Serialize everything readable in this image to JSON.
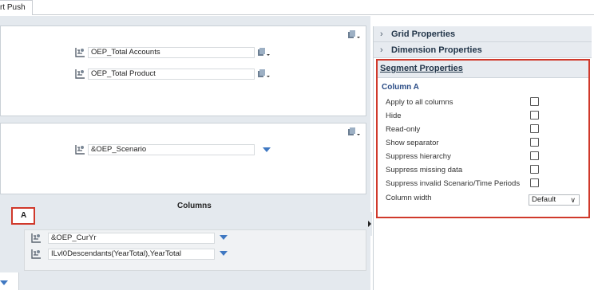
{
  "tabs": [
    {
      "label": "rt Push"
    }
  ],
  "point_of_view": {
    "dimensions": [
      {
        "value": "OEP_Total Accounts"
      },
      {
        "value": "OEP_Total Product"
      }
    ]
  },
  "page": {
    "dimensions": [
      {
        "value": "&OEP_Scenario"
      }
    ]
  },
  "columns": {
    "title": "Columns",
    "segment_label": "A",
    "dimensions": [
      {
        "value": "&OEP_CurYr"
      },
      {
        "value": "ILvl0Descendants(YearTotal),YearTotal"
      }
    ]
  },
  "properties": {
    "grid_properties": "Grid Properties",
    "dimension_properties": "Dimension Properties",
    "segment_properties": "Segment Properties",
    "segment_name": "Column A",
    "options": [
      {
        "label": "Apply to all columns",
        "checked": false
      },
      {
        "label": "Hide",
        "checked": false
      },
      {
        "label": "Read-only",
        "checked": false
      },
      {
        "label": "Show separator",
        "checked": false
      },
      {
        "label": "Suppress hierarchy",
        "checked": false
      },
      {
        "label": "Suppress missing data",
        "checked": false
      },
      {
        "label": "Suppress invalid Scenario/Time Periods",
        "checked": false
      }
    ],
    "column_width_label": "Column width",
    "column_width_value": "Default"
  },
  "colors": {
    "highlight": "#d0392b",
    "accent": "#3f78c2",
    "panel_bg": "#e4e9ee"
  }
}
